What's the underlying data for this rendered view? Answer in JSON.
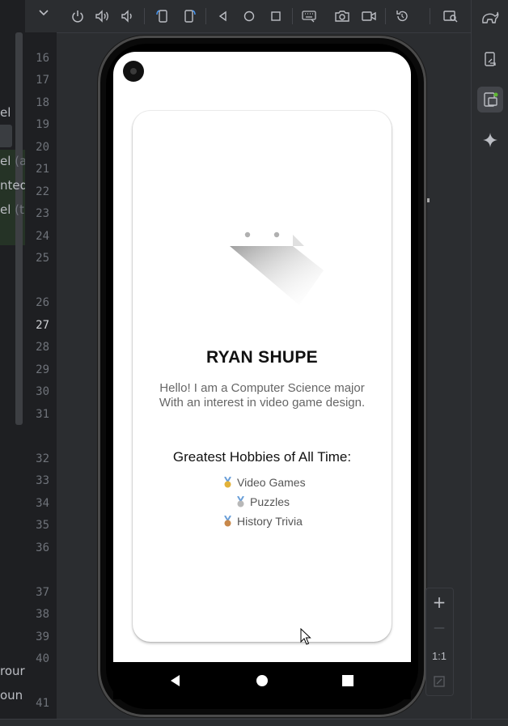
{
  "editor": {
    "fragments": [
      {
        "text": "el",
        "dim": ""
      },
      {
        "text": "el ",
        "dim": "(a"
      },
      {
        "text": "nted",
        "dim": ""
      },
      {
        "text": "el ",
        "dim": "(t"
      },
      {
        "text": "rour",
        "dim": ""
      },
      {
        "text": "oun",
        "dim": ""
      }
    ],
    "line_numbers": [
      "16",
      "17",
      "18",
      "19",
      "20",
      "21",
      "22",
      "23",
      "24",
      "25",
      "26",
      "27",
      "28",
      "29",
      "30",
      "31",
      "32",
      "33",
      "34",
      "35",
      "36",
      "37",
      "38",
      "39",
      "40",
      "41"
    ],
    "current_line": "27"
  },
  "toolbar": {
    "icons": [
      "chevron-down-icon",
      "power-icon",
      "volume-up-icon",
      "volume-down-icon",
      "rotate-left-icon",
      "rotate-right-icon",
      "back-icon",
      "home-icon",
      "overview-icon",
      "keyboard-icon",
      "camera-icon",
      "video-icon",
      "reset-icon",
      "inspect-icon"
    ]
  },
  "app": {
    "name": "RYAN SHUPE",
    "bio_line1": "Hello! I am a Computer Science major",
    "bio_line2": "With an interest in video game design.",
    "hobbies_title": "Greatest Hobbies of All Time:",
    "hobbies": [
      {
        "label": "Video Games",
        "medal": "gold"
      },
      {
        "label": "Puzzles",
        "medal": "silver"
      },
      {
        "label": "History Trivia",
        "medal": "bronze"
      }
    ]
  },
  "zoom": {
    "plus": "+",
    "minus": "—",
    "one_to_one": "1:1"
  },
  "colors": {
    "ide_bg": "#2b2d30",
    "editor_bg": "#1e1f22",
    "card_bg": "#ffffff",
    "name_color": "#111111",
    "bio_color": "#666666"
  }
}
